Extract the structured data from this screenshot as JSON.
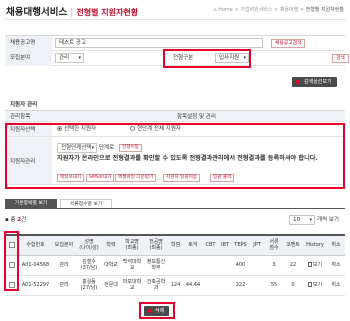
{
  "header": {
    "title": "채용대행서비스",
    "subtitle": "전형별 지원자현황",
    "breadcrumb": [
      "Home",
      "기업회원서비스",
      "채용대행",
      "전형별 지원자현황"
    ]
  },
  "filter": {
    "notice_label": "채용공고명",
    "notice_value": "테스트 공고",
    "notice_button": "채용공고검색",
    "field_label": "모집분야",
    "field_value": "관리",
    "stage_label": "전형구분",
    "stage_value": "입사지원",
    "search_button": "검색",
    "batch_button": "감색상선보기"
  },
  "manage": {
    "section_title": "지원자 관리",
    "col_type": "관리항목",
    "col_setting": "항목설정 및 관리",
    "select_label": "지원자선택",
    "radio_selected": "선택한 지원자",
    "radio_all": "현단계 전체 지원자",
    "manage_label": "지원자관리",
    "stage_select": "전형단계선택",
    "stage_suffix": "단계로",
    "move_button": "전형이동",
    "notice_text": "지원자가 온라인으로 전형결과를 확인할 수 있도록 전형결과관리에서 전형결과를 등록하셔야 합니다.",
    "actions": [
      "메일보내기",
      "SMS보내기",
      "엑셀파일 다운받기",
      "지원자 일괄이동",
      "일괄 출력"
    ]
  },
  "tabs": {
    "active": "기본항목별 보기",
    "inactive": "서류점수별 보기"
  },
  "list": {
    "total_prefix": "총",
    "total_count": "2",
    "total_suffix": "건",
    "page_size": "10",
    "page_size_suffix": "개씩 보기",
    "columns": [
      "",
      "수험번호",
      "모집분야",
      "성명\n(나이/성)",
      "학력",
      "학교명\n(최종)",
      "전공명\n(최종)",
      "학점",
      "토익",
      "CBT",
      "IBT",
      "TEPS",
      "JPT",
      "서류\n점수",
      "코멘트",
      "History",
      "취소"
    ],
    "rows": [
      [
        "",
        "A01-04568",
        "관리",
        "김철수\n(37/남)",
        "대학교",
        "백석대학\n교",
        "정보통신\n학부",
        "",
        "",
        "",
        "",
        "400",
        "",
        "3",
        "22",
        "보기",
        "취소"
      ],
      [
        "",
        "A01-52297",
        "관리",
        "홍길동\n(27/남)",
        "전문대",
        "마포대학\n교",
        "건축공학\n과",
        "124",
        "44,44",
        "",
        "",
        "222",
        "",
        "55",
        "0",
        "보기",
        "취소"
      ]
    ]
  },
  "footer": {
    "delete_button": "삭제"
  },
  "colors": {
    "accent": "#c8102e",
    "highlight": "#e6002c",
    "label_bg": "#eef1f5"
  }
}
